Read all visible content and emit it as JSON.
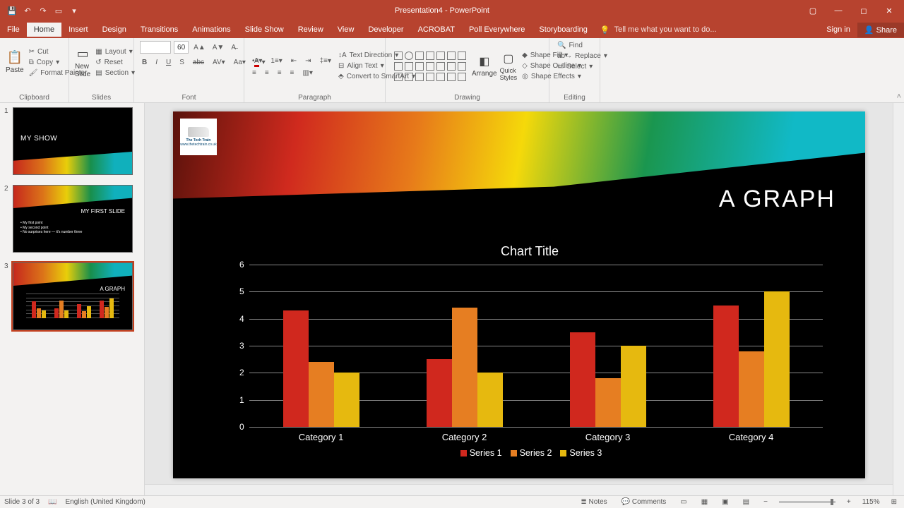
{
  "titlebar": {
    "doc_title": "Presentation4 - PowerPoint"
  },
  "menu": {
    "file": "File",
    "home": "Home",
    "insert": "Insert",
    "design": "Design",
    "transitions": "Transitions",
    "animations": "Animations",
    "slideshow": "Slide Show",
    "review": "Review",
    "view": "View",
    "developer": "Developer",
    "acrobat": "ACROBAT",
    "poll": "Poll Everywhere",
    "story": "Storyboarding",
    "tellme": "Tell me what you want to do...",
    "signin": "Sign in",
    "share": "Share"
  },
  "ribbon": {
    "paste": "Paste",
    "cut": "Cut",
    "copy": "Copy",
    "format_painter": "Format Painter",
    "clipboard": "Clipboard",
    "new_slide": "New Slide",
    "layout": "Layout",
    "reset": "Reset",
    "section": "Section",
    "slides": "Slides",
    "font_size": "60",
    "font": "Font",
    "paragraph": "Paragraph",
    "text_direction": "Text Direction",
    "align_text": "Align Text",
    "convert_smartart": "Convert to SmartArt",
    "arrange": "Arrange",
    "quick_styles": "Quick Styles",
    "shape_fill": "Shape Fill",
    "shape_outline": "Shape Outline",
    "shape_effects": "Shape Effects",
    "drawing": "Drawing",
    "find": "Find",
    "replace": "Replace",
    "select": "Select",
    "editing": "Editing"
  },
  "thumbs": {
    "n1": "1",
    "n2": "2",
    "n3": "3",
    "t1": "MY SHOW",
    "t2": "MY FIRST SLIDE",
    "t3": "A GRAPH",
    "t3_chart": "Chart Title",
    "b1": "• My first point",
    "b2": "• My second point",
    "b3": "• No surprises here — it's number three"
  },
  "slide": {
    "title": "A GRAPH",
    "logo_top": "The Tech Train",
    "logo_url": "www.thetechtrain.co.uk"
  },
  "chart_data": {
    "type": "bar",
    "title": "Chart Title",
    "categories": [
      "Category 1",
      "Category 2",
      "Category 3",
      "Category 4"
    ],
    "series": [
      {
        "name": "Series 1",
        "color": "#d0281e",
        "values": [
          4.3,
          2.5,
          3.5,
          4.5
        ]
      },
      {
        "name": "Series 2",
        "color": "#e67e22",
        "values": [
          2.4,
          4.4,
          1.8,
          2.8
        ]
      },
      {
        "name": "Series 3",
        "color": "#e6b90f",
        "values": [
          2.0,
          2.0,
          3.0,
          5.0
        ]
      }
    ],
    "ylim": [
      0,
      6
    ],
    "yticks": [
      0,
      1,
      2,
      3,
      4,
      5,
      6
    ],
    "xlabel": "",
    "ylabel": ""
  },
  "status": {
    "slide": "Slide 3 of 3",
    "lang": "English (United Kingdom)",
    "notes": "Notes",
    "comments": "Comments",
    "zoom": "115%"
  }
}
